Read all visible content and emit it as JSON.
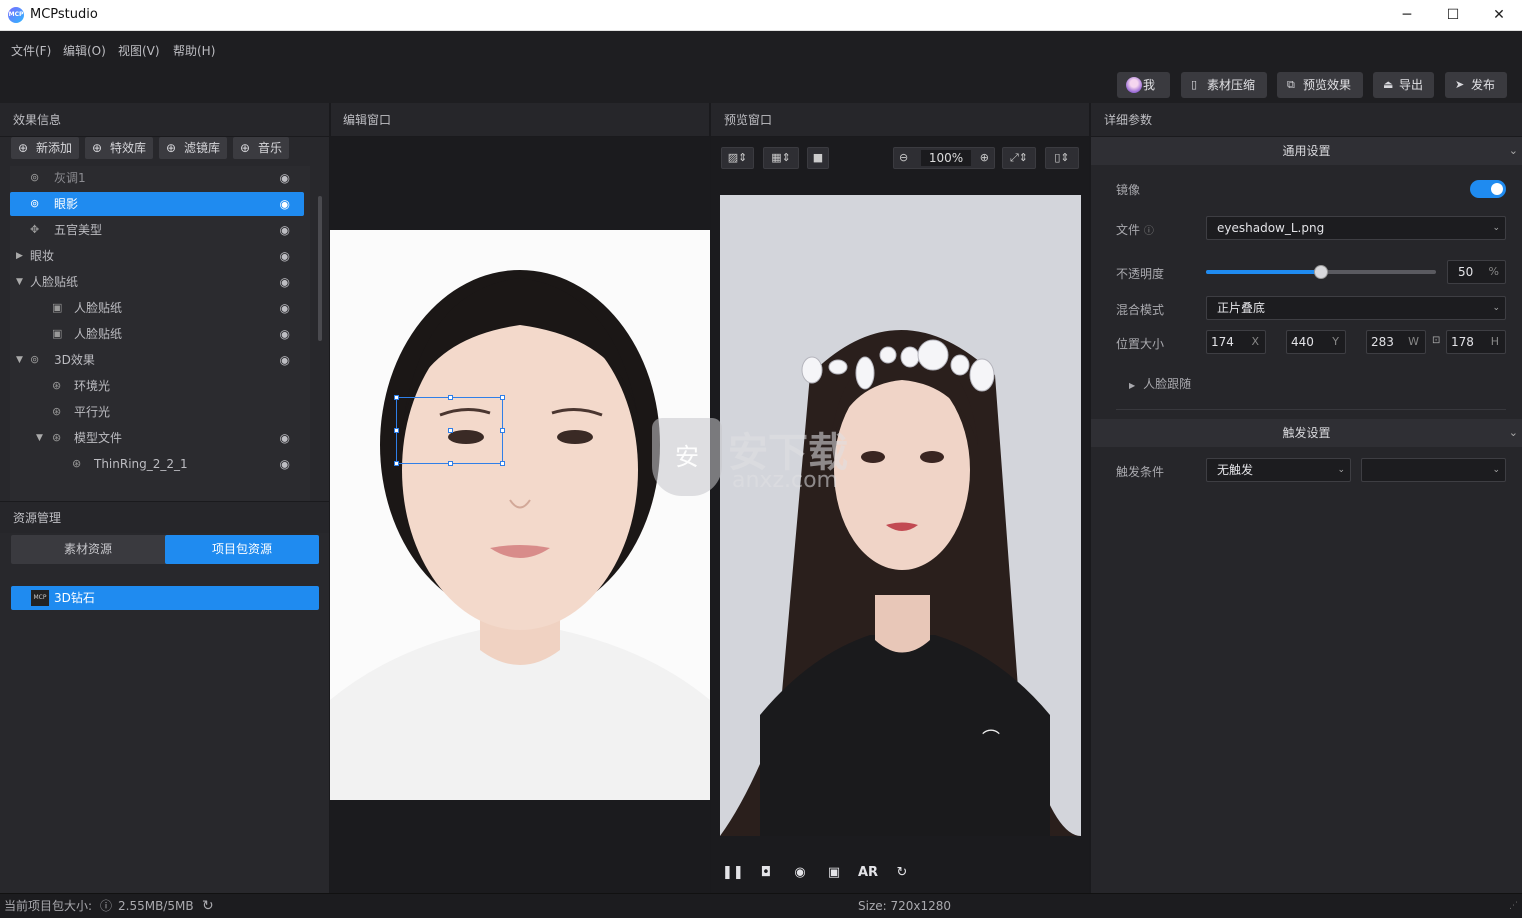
{
  "app": {
    "title": "MCPstudio",
    "logo_text": "MCP"
  },
  "window_controls": {
    "minimize": "─",
    "maximize": "☐",
    "close": "✕"
  },
  "menu": [
    "文件(F)",
    "编辑(O)",
    "视图(V)",
    "帮助(H)"
  ],
  "toolbar": {
    "me": "我",
    "compress": "素材压缩",
    "preview": "预览效果",
    "export": "导出",
    "publish": "发布"
  },
  "panels": {
    "effects": "效果信息",
    "edit": "编辑窗口",
    "preview": "预览窗口",
    "detail": "详细参数"
  },
  "effect_buttons": {
    "add": "新添加",
    "fx_lib": "特效库",
    "filter_lib": "滤镜库",
    "music": "音乐"
  },
  "tree": [
    {
      "label": "灰调1",
      "selected": false
    },
    {
      "label": "眼影",
      "selected": true
    },
    {
      "label": "五官美型",
      "selected": false
    },
    {
      "label": "眼妆",
      "selected": false
    },
    {
      "label": "人脸贴纸",
      "selected": false
    },
    {
      "label": "人脸贴纸",
      "selected": false
    },
    {
      "label": "人脸贴纸",
      "selected": false
    },
    {
      "label": "3D效果",
      "selected": false
    },
    {
      "label": "环境光",
      "selected": false
    },
    {
      "label": "平行光",
      "selected": false
    },
    {
      "label": "模型文件",
      "selected": false
    },
    {
      "label": "ThinRing_2_2_1",
      "selected": false
    }
  ],
  "resources": {
    "title": "资源管理",
    "tab_material": "素材资源",
    "tab_package": "项目包资源",
    "item": "3D钻石",
    "item_badge": "MCP"
  },
  "preview_toolbar": {
    "zoom": "100%"
  },
  "preview_controls": {
    "ar": "AR"
  },
  "watermark": {
    "text": "安下载",
    "sub": "anxz.com",
    "shield": "安"
  },
  "general": {
    "title": "通用设置",
    "mirror_label": "镜像",
    "mirror_on": true,
    "file_label": "文件",
    "file_value": "eyeshadow_L.png",
    "opacity_label": "不透明度",
    "opacity_value": "50",
    "opacity_unit": "%",
    "blend_label": "混合模式",
    "blend_value": "正片叠底",
    "pos_label": "位置大小",
    "x": "174",
    "x_unit": "X",
    "y": "440",
    "y_unit": "Y",
    "w": "283",
    "w_unit": "W",
    "h": "178",
    "h_unit": "H",
    "face_track": "人脸跟随"
  },
  "trigger": {
    "title": "触发设置",
    "cond_label": "触发条件",
    "cond_value": "无触发",
    "cond_value2": ""
  },
  "status": {
    "pkg_label": "当前项目包大小:",
    "pkg_size": "2.55MB/5MB",
    "size": "Size: 720x1280"
  },
  "colors": {
    "accent": "#1f8bf0",
    "bg": "#26262a"
  }
}
